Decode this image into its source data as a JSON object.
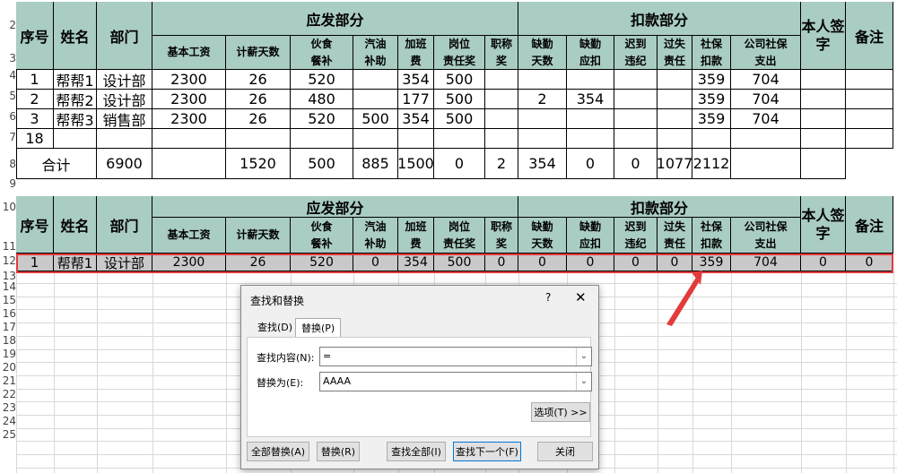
{
  "row_numbers": [
    "2",
    "3",
    "4",
    "5",
    "6",
    "7",
    "8",
    "9",
    "10",
    "11",
    "12",
    "13",
    "14",
    "15",
    "16",
    "17",
    "18",
    "19",
    "20",
    "21",
    "22",
    "23",
    "24",
    "25"
  ],
  "table1": {
    "h_seq": "序号",
    "h_name": "姓名",
    "h_dept": "部门",
    "h_payable": "应发部分",
    "h_deduct": "扣款部分",
    "h_sign": "本人签字",
    "h_note": "备注",
    "sub": [
      {
        "top": "基本工资",
        "bot": ""
      },
      {
        "top": "计薪天数",
        "bot": ""
      },
      {
        "top": "伙食",
        "bot": "餐补"
      },
      {
        "top": "汽油",
        "bot": "补助"
      },
      {
        "top": "加班",
        "bot": "费"
      },
      {
        "top": "岗位",
        "bot": "责任奖"
      },
      {
        "top": "职称",
        "bot": "奖"
      },
      {
        "top": "缺勤",
        "bot": "天数"
      },
      {
        "top": "缺勤",
        "bot": "应扣"
      },
      {
        "top": "迟到",
        "bot": "违纪"
      },
      {
        "top": "过失",
        "bot": "责任"
      },
      {
        "top": "社保",
        "bot": "扣款"
      },
      {
        "top": "公司社保",
        "bot": "支出"
      }
    ],
    "rows": [
      [
        "1",
        "帮帮1",
        "设计部",
        "2300",
        "26",
        "520",
        "",
        "354",
        "500",
        "",
        "",
        "",
        "",
        "",
        "359",
        "704",
        "",
        ""
      ],
      [
        "2",
        "帮帮2",
        "设计部",
        "2300",
        "26",
        "480",
        "",
        "177",
        "500",
        "",
        "2",
        "354",
        "",
        "",
        "359",
        "704",
        "",
        ""
      ],
      [
        "3",
        "帮帮3",
        "销售部",
        "2300",
        "26",
        "520",
        "500",
        "354",
        "500",
        "",
        "",
        "",
        "",
        "",
        "359",
        "704",
        "",
        ""
      ],
      [
        "18",
        "",
        "",
        "",
        "",
        "",
        "",
        "",
        "",
        "",
        "",
        "",
        "",
        "",
        "",
        "",
        "",
        ""
      ]
    ],
    "total": [
      "合计",
      "6900",
      "",
      "1520",
      "500",
      "885",
      "1500",
      "0",
      "2",
      "354",
      "0",
      "0",
      "1077",
      "2112",
      "",
      ""
    ]
  },
  "table2": {
    "row": [
      "1",
      "帮帮1",
      "设计部",
      "2300",
      "26",
      "520",
      "0",
      "354",
      "500",
      "0",
      "0",
      "0",
      "0",
      "0",
      "359",
      "704",
      "0",
      "0"
    ]
  },
  "dialog": {
    "title": "查找和替换",
    "help": "?",
    "close": "✕",
    "tab_find": "查找(D)",
    "tab_replace": "替换(P)",
    "find_label": "查找内容(N):",
    "find_value": "=",
    "replace_label": "替换为(E):",
    "replace_value": "AAAA",
    "options_btn": "选项(T) >>",
    "btn_replace_all": "全部替换(A)",
    "btn_replace": "替换(R)",
    "btn_find_all": "查找全部(I)",
    "btn_find_next": "查找下一个(F)",
    "btn_close": "关闭"
  },
  "colors": {
    "header_fill": "#a9ccc3",
    "highlight": "#e23b3b",
    "arrow": "#e23b3b"
  }
}
